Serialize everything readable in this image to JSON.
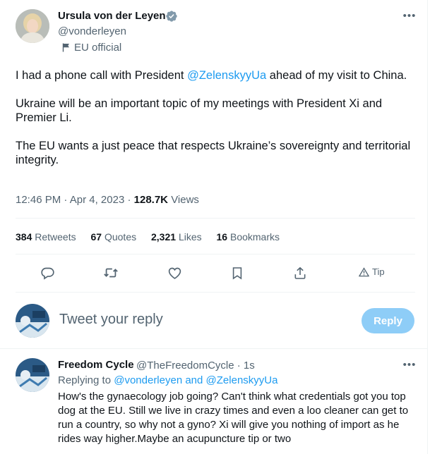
{
  "tweet": {
    "author": {
      "name": "Ursula von der Leyen",
      "handle": "@vonderleyen",
      "affiliation": "EU official"
    },
    "paragraphs": [
      {
        "before": "I had a phone call with President ",
        "mention": "@ZelenskyyUa",
        "after": " ahead of my visit to China."
      },
      {
        "text": "Ukraine will be an important topic of my meetings with President Xi and Premier Li."
      },
      {
        "text": "The EU wants a just peace that respects Ukraine’s sovereignty and territorial integrity."
      }
    ],
    "time": "12:46 PM",
    "date": "Apr 4, 2023",
    "separator": "·",
    "views_count": "128.7K",
    "views_label": "Views"
  },
  "stats": [
    {
      "count": "384",
      "label": "Retweets"
    },
    {
      "count": "67",
      "label": "Quotes"
    },
    {
      "count": "2,321",
      "label": "Likes"
    },
    {
      "count": "16",
      "label": "Bookmarks"
    }
  ],
  "actions": {
    "tip_label": "Tip"
  },
  "composer": {
    "placeholder": "Tweet your reply",
    "reply_button": "Reply"
  },
  "reply": {
    "name": "Freedom Cycle",
    "handle_time": "@TheFreedomCycle · 1s",
    "replying_prefix": "Replying to ",
    "replying_to": "@vonderleyen and @ZelenskyyUa",
    "text": "How's the gynaecology job going? Can't think what credentials got you top dog at the EU. Still we live in crazy times and even a loo cleaner can get to run a country, so why not a gyno? Xi will give you nothing of import as he rides way higher.Maybe an acupuncture tip or two"
  },
  "colors": {
    "accent": "#1d9bf0",
    "secondary_text": "#536471",
    "reply_button_disabled": "#8ecdf7"
  }
}
